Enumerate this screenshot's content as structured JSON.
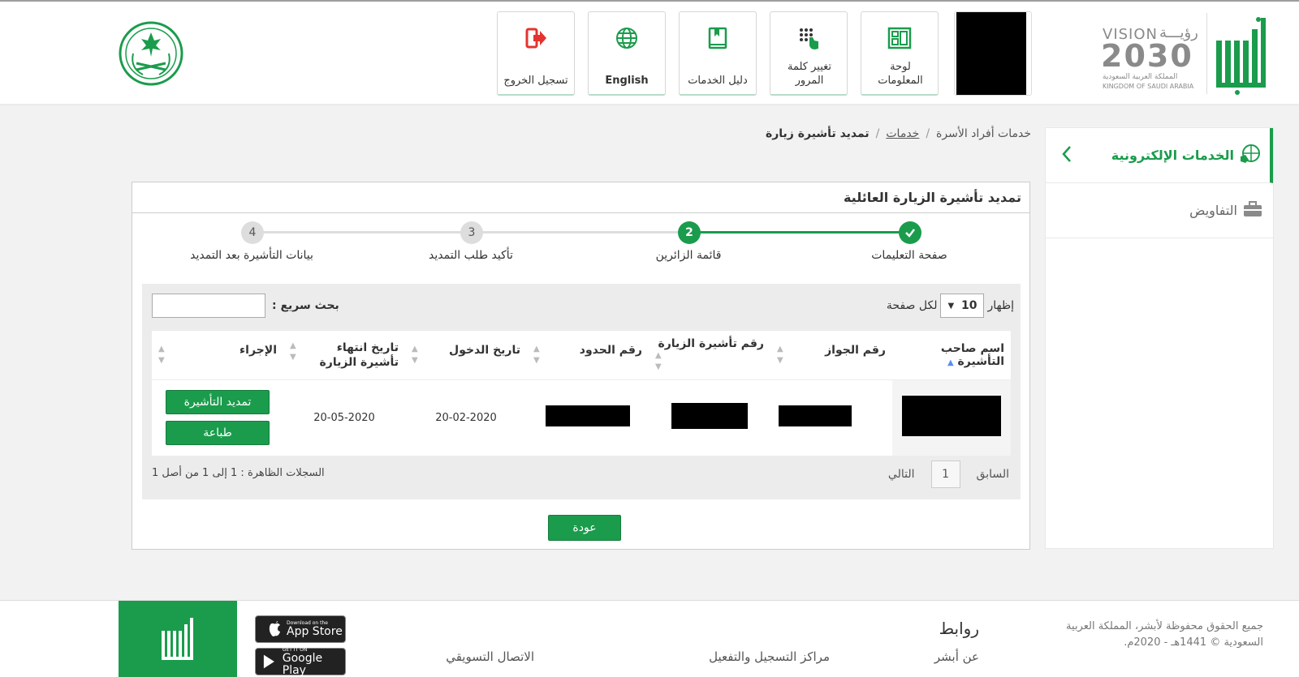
{
  "header": {
    "nav": [
      {
        "label": "لوحة المعلومات",
        "icon": "dashboard-icon"
      },
      {
        "label": "تغيير كلمة المرور",
        "icon": "keypad-icon"
      },
      {
        "label": "دليل الخدمات",
        "icon": "book-icon"
      },
      {
        "label": "English",
        "icon": "globe-icon"
      },
      {
        "label": "تسجيل الخروج",
        "icon": "logout-icon"
      }
    ],
    "vision": {
      "word": "VISION",
      "arabic": "رؤيـــة",
      "year": "2030",
      "kingdom_ar": "المملكة العربية السعودية",
      "kingdom_en": "KINGDOM OF SAUDI ARABIA"
    },
    "brand_color": "#1a9c4c"
  },
  "sidebar": {
    "items": [
      {
        "label": "الخدمات الإلكترونية",
        "icon": "globe-hand-icon",
        "active": true
      },
      {
        "label": "التفاويض",
        "icon": "briefcase-icon",
        "active": false
      }
    ]
  },
  "breadcrumb": {
    "root": "خدمات أفراد الأسرة",
    "link": "خدمات",
    "current": "تمديد تأشيرة زيارة",
    "sep": "/"
  },
  "panel": {
    "title": "تمديد تأشيرة الزيارة العائلية",
    "steps": [
      {
        "num": "✓",
        "label": "صفحة التعليمات",
        "state": "done"
      },
      {
        "num": "2",
        "label": "قائمة الزائرين",
        "state": "current"
      },
      {
        "num": "3",
        "label": "تأكيد طلب التمديد",
        "state": "pending"
      },
      {
        "num": "4",
        "label": "بيانات التأشيرة بعد التمديد",
        "state": "pending"
      }
    ],
    "show_label": "إظهار",
    "page_size": "10",
    "per_page_label": "لكل صفحة",
    "search_label": "بحث سريع :",
    "search_value": "",
    "columns": [
      "اسم صاحب التأشيرة",
      "رقم الجواز",
      "رقم تأشيرة الزيارة",
      "رقم الحدود",
      "تاريخ الدخول",
      "تاريخ انتهاء تأشيرة الزيارة",
      "الإجراء"
    ],
    "rows": [
      {
        "entry_date": "20-02-2020",
        "expiry_date": "20-05-2020",
        "extend_label": "تمديد التأشيرة",
        "print_label": "طباعة"
      }
    ],
    "pager": {
      "prev": "السابق",
      "page": "1",
      "next": "التالي"
    },
    "records_info": "السجلات الظاهرة : 1 إلى 1 من أصل 1",
    "back_label": "عودة"
  },
  "footer": {
    "copyright": "جميع الحقوق محفوظة لأبشر، المملكة العربية السعودية © 1441هـ - 2020م.",
    "links_title": "روابط",
    "links": [
      "عن أبشر",
      "مراكز التسجيل والتفعيل",
      "الاتصال التسويقي"
    ],
    "app_store": {
      "small": "Download on the",
      "big": "App Store"
    },
    "google_play": {
      "small": "GET IT ON",
      "big": "Google Play"
    }
  }
}
